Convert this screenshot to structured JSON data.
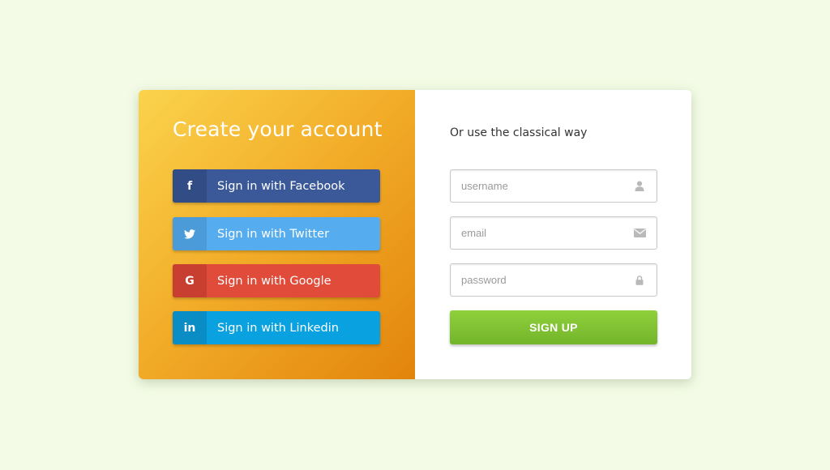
{
  "colors": {
    "background": "#f3fbe6",
    "facebook": "#3b5998",
    "twitter": "#55acee",
    "google": "#e04b3a",
    "linkedin": "#0aa1e0",
    "signup": "#7fc232"
  },
  "left_panel": {
    "title": "Create your account",
    "buttons": [
      {
        "icon": "facebook-icon",
        "glyph": "f",
        "label": "Sign in with Facebook"
      },
      {
        "icon": "twitter-icon",
        "glyph": "",
        "label": "Sign in with Twitter"
      },
      {
        "icon": "google-icon",
        "glyph": "G",
        "label": "Sign in with Google"
      },
      {
        "icon": "linkedin-icon",
        "glyph": "in",
        "label": "Sign in with Linkedin"
      }
    ]
  },
  "right_panel": {
    "subtitle": "Or use the classical way",
    "fields": [
      {
        "placeholder": "username",
        "value": "",
        "icon": "user-icon"
      },
      {
        "placeholder": "email",
        "value": "",
        "icon": "envelope-icon"
      },
      {
        "placeholder": "password",
        "value": "",
        "icon": "lock-icon"
      }
    ],
    "submit_label": "SIGN UP"
  }
}
